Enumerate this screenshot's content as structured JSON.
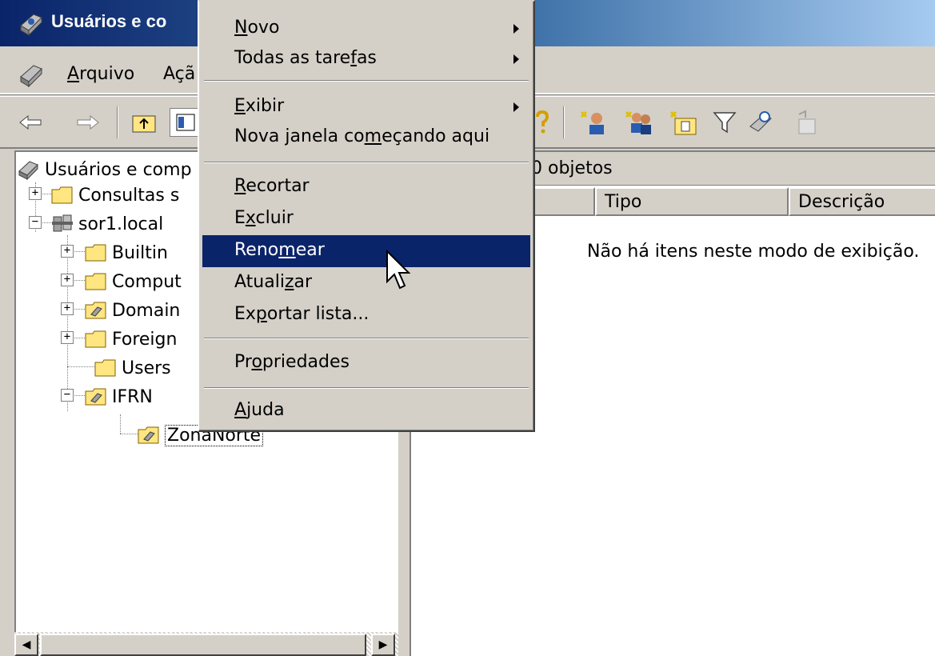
{
  "window": {
    "title": "Usuários e co"
  },
  "menubar": {
    "arquivo": {
      "pre": "",
      "key": "A",
      "post": "rquivo"
    },
    "acao": "Açã"
  },
  "tree": {
    "root": "Usuários e comp",
    "items": [
      {
        "label": "Consultas s"
      },
      {
        "label": "sor1.local"
      },
      {
        "label": "Builtin"
      },
      {
        "label": "Comput"
      },
      {
        "label": "Domain"
      },
      {
        "label": "Foreign"
      },
      {
        "label": "Users"
      },
      {
        "label": "IFRN"
      },
      {
        "label": "ZonaNorte"
      }
    ]
  },
  "right_pane": {
    "header": "0 objetos",
    "columns": [
      "Tipo",
      "Descrição"
    ],
    "empty_message": "Não há itens neste modo de exibição."
  },
  "context_menu": {
    "items": [
      {
        "pre": "",
        "key": "N",
        "post": "ovo"
      },
      {
        "pre": "Todas as tare",
        "key": "f",
        "post": "as"
      },
      {
        "pre": "",
        "key": "E",
        "post": "xibir"
      },
      {
        "pre": "Nova janela co",
        "key": "m",
        "post": "eçando aqui"
      },
      {
        "pre": "",
        "key": "R",
        "post": "ecortar"
      },
      {
        "pre": "E",
        "key": "x",
        "post": "cluir"
      },
      {
        "pre": "Reno",
        "key": "m",
        "post": "ear"
      },
      {
        "pre": "Atuali",
        "key": "z",
        "post": "ar"
      },
      {
        "pre": "Ex",
        "key": "p",
        "post": "ortar lista..."
      },
      {
        "pre": "Pr",
        "key": "o",
        "post": "priedades"
      },
      {
        "pre": "",
        "key": "A",
        "post": "juda"
      }
    ],
    "highlighted": "Renomear"
  },
  "colors": {
    "menu_highlight": "#0a246a",
    "title_gradient_start": "#0a246a",
    "face": "#d4d0c8"
  },
  "icons": {
    "app": "mmc-console-icon",
    "toolbar": [
      "back-arrow-icon",
      "forward-arrow-icon",
      "up-folder-icon",
      "show-hide-tree-icon",
      "help-icon",
      "new-user-icon",
      "new-group-icon",
      "new-ou-icon",
      "filter-icon",
      "find-icon",
      "add-to-group-icon"
    ]
  }
}
